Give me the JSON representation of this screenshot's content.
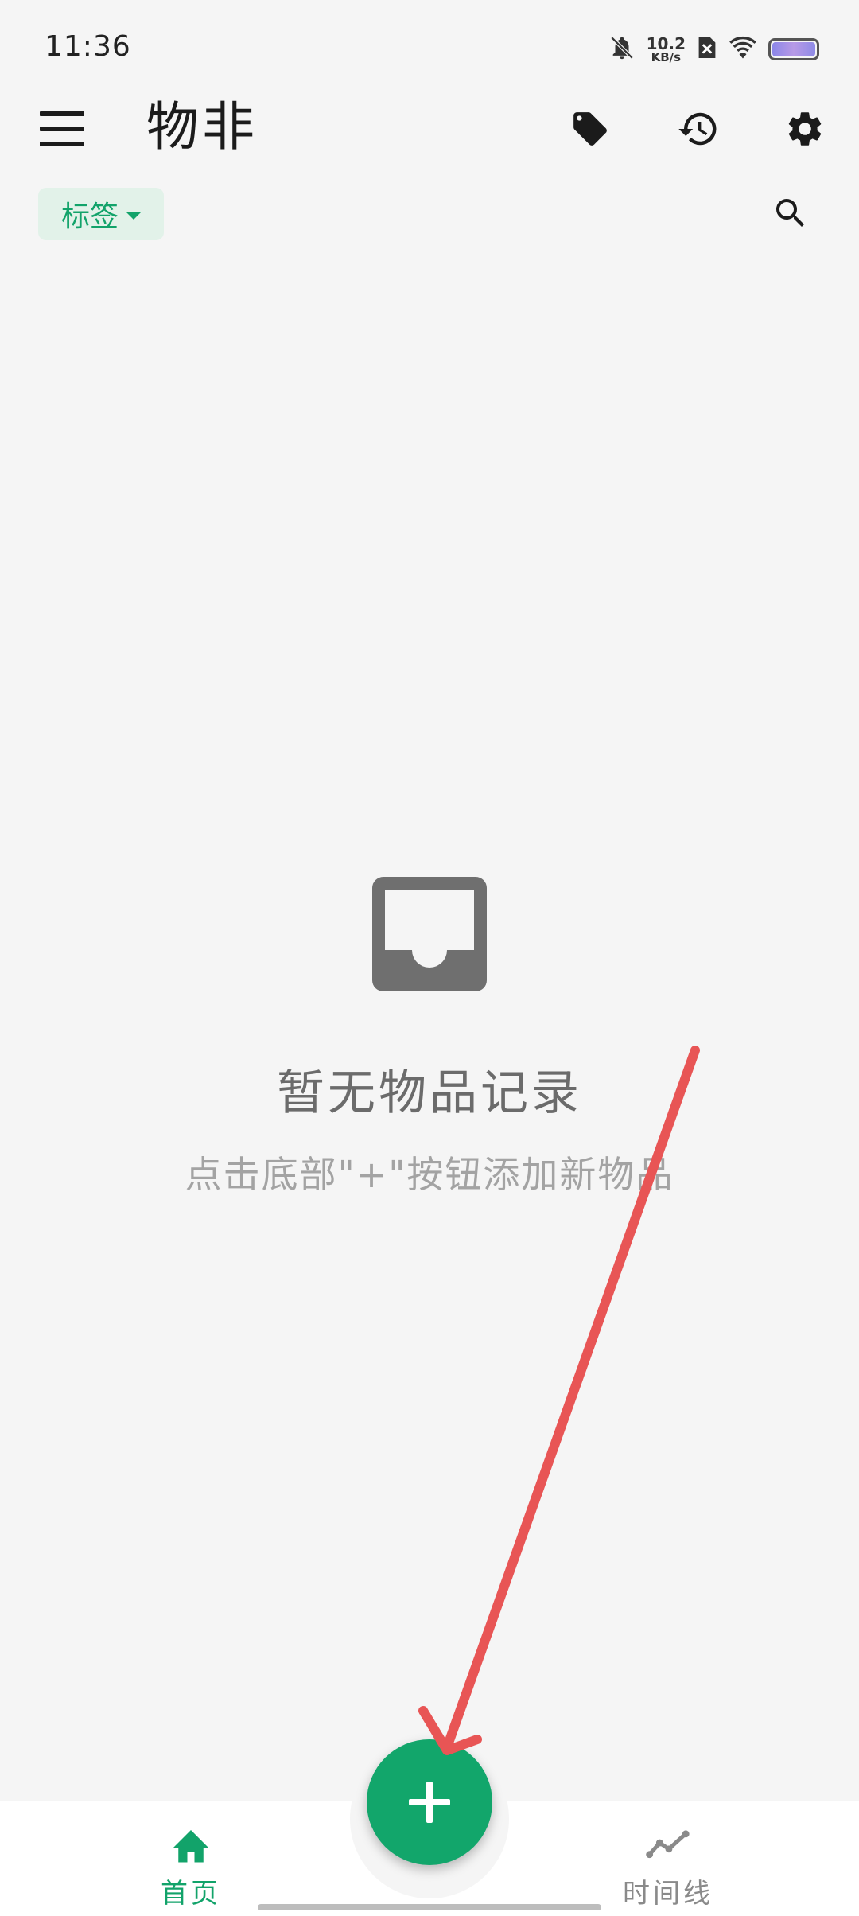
{
  "status_bar": {
    "time": "11:36",
    "net_speed_value": "10.2",
    "net_speed_unit": "KB/s",
    "icons": [
      "bell-off-icon",
      "sim-off-icon",
      "wifi-icon",
      "battery-icon"
    ]
  },
  "app_bar": {
    "title": "物非",
    "actions": [
      "tag-icon",
      "history-icon",
      "settings-icon"
    ]
  },
  "filter": {
    "tag_chip_label": "标签"
  },
  "empty_state": {
    "title": "暂无物品记录",
    "hint": "点击底部\"+\"按钮添加新物品"
  },
  "bottom_nav": {
    "items": [
      {
        "label": "首页",
        "icon": "home-icon",
        "active": true
      },
      {
        "label": "时间线",
        "icon": "timeline-icon",
        "active": false
      }
    ]
  },
  "colors": {
    "accent": "#12a66b",
    "background": "#f5f5f5",
    "annotation_arrow": "#e85555"
  }
}
